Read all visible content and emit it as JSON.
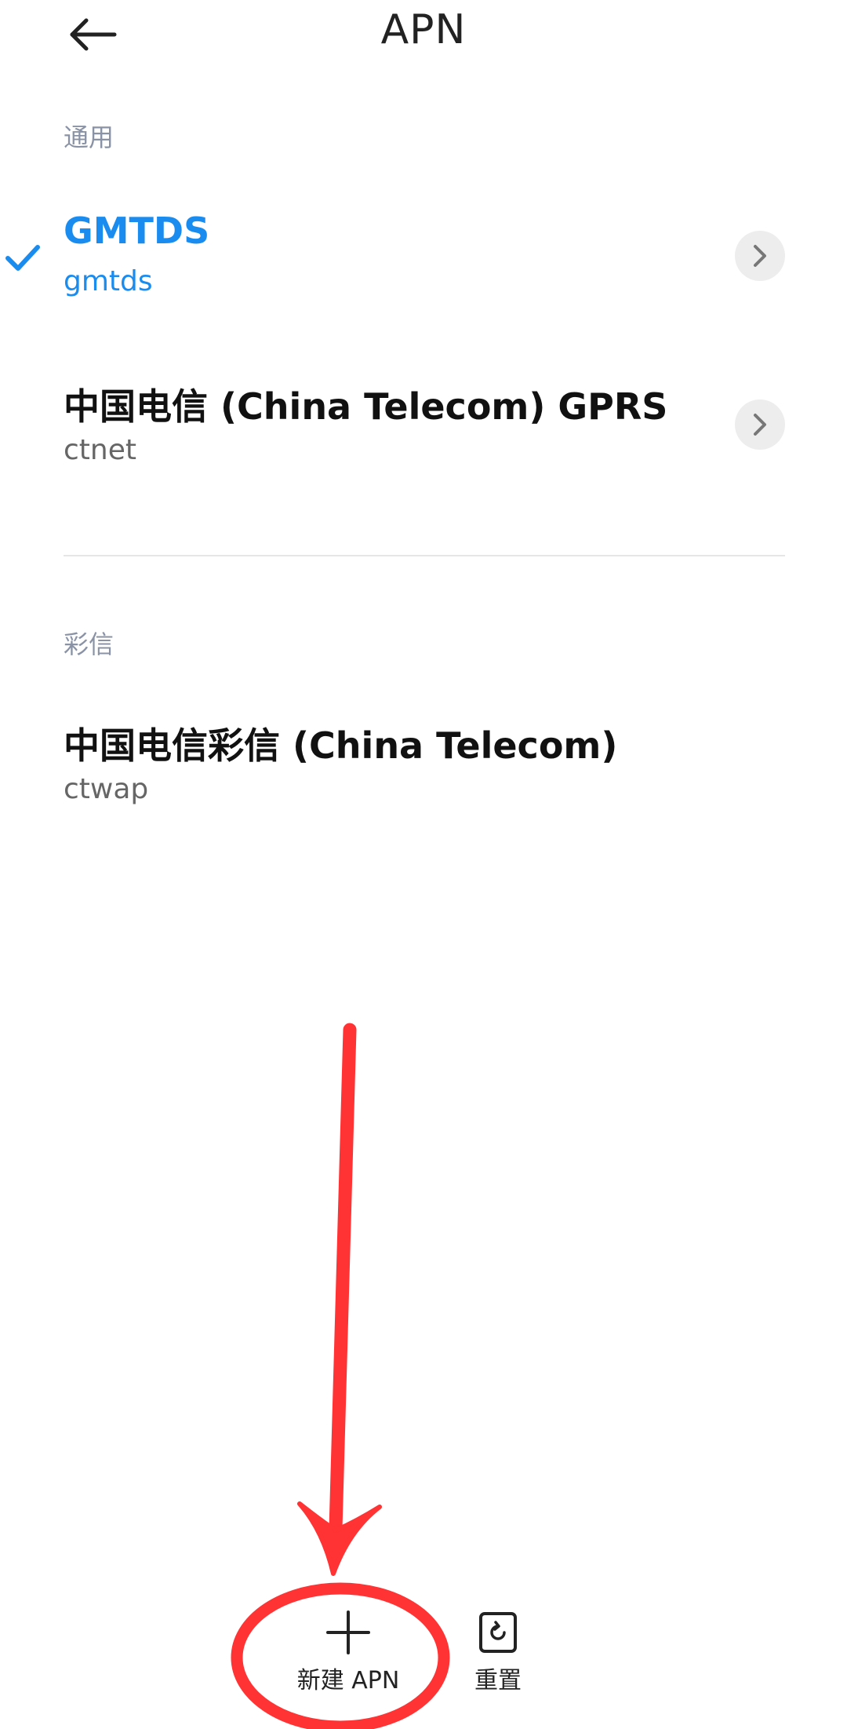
{
  "header": {
    "title": "APN"
  },
  "sections": [
    {
      "label": "通用",
      "items": [
        {
          "name": "GMTDS",
          "apn": "gmtds",
          "selected": true
        },
        {
          "name": "中国电信 (China Telecom) GPRS",
          "apn": "ctnet",
          "selected": false
        }
      ]
    },
    {
      "label": "彩信",
      "items": [
        {
          "name": "中国电信彩信 (China Telecom)",
          "apn": "ctwap",
          "selected": false
        }
      ]
    }
  ],
  "bottom_bar": {
    "new_apn_label": "新建 APN",
    "reset_label": "重置"
  },
  "colors": {
    "accent": "#1a8cf0",
    "annotation": "#ff3333",
    "section_label": "#8a93a6"
  }
}
